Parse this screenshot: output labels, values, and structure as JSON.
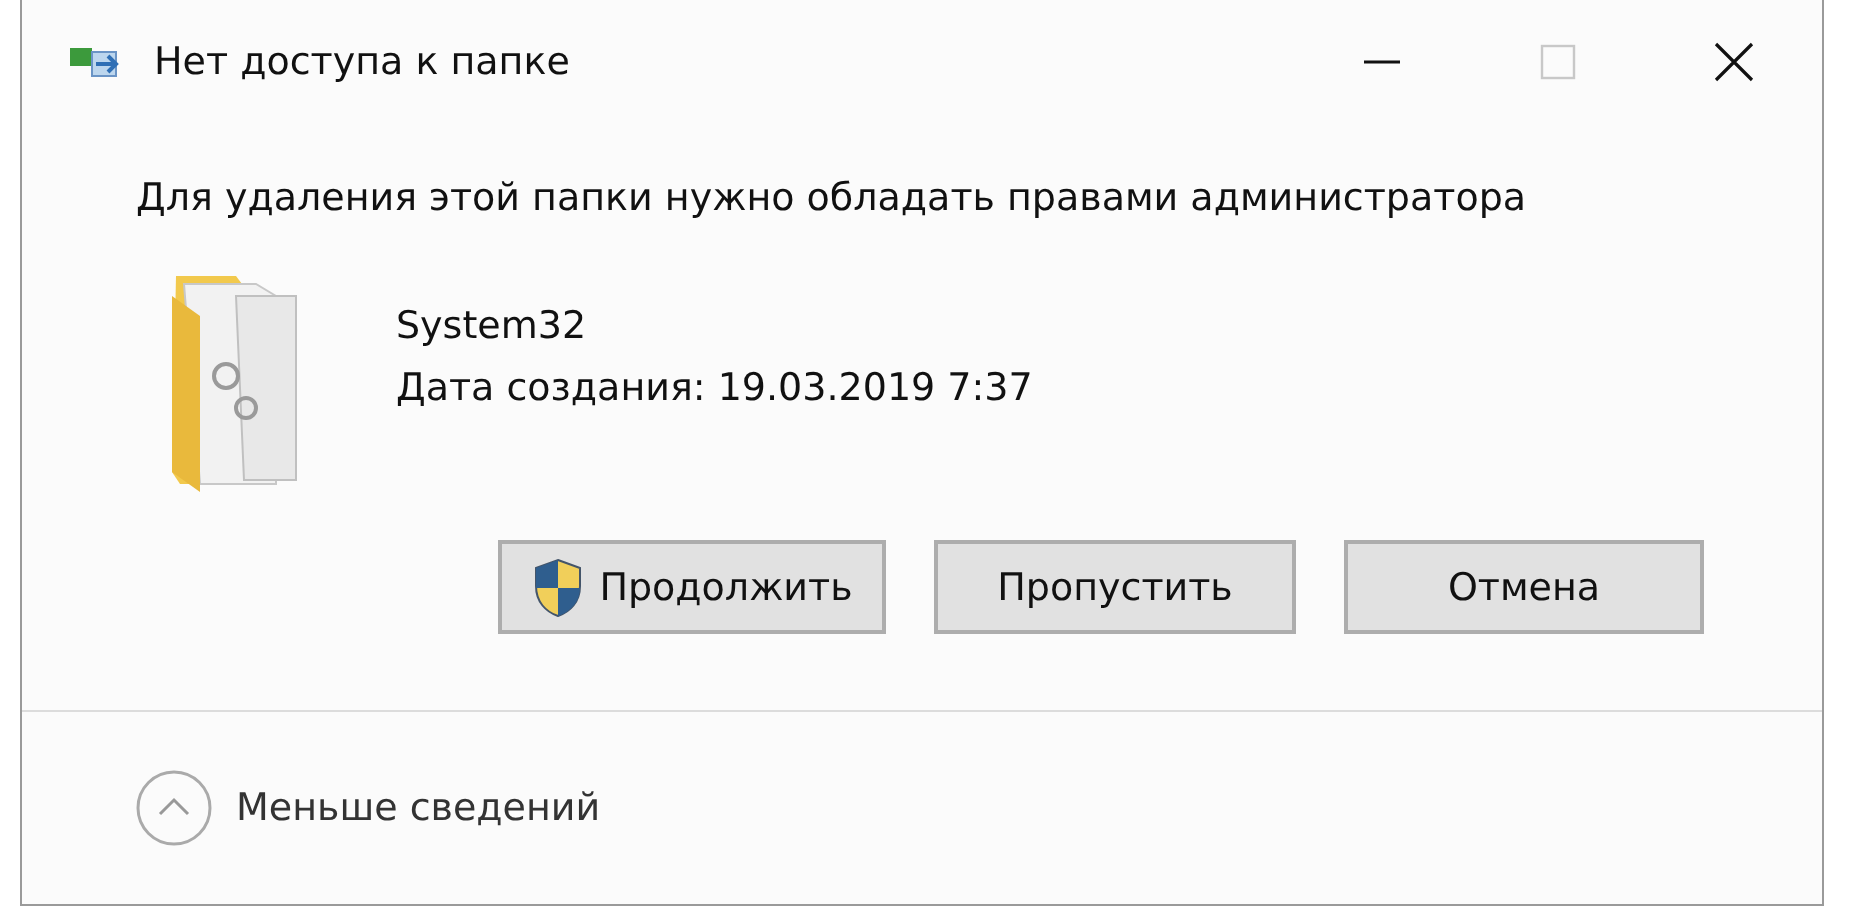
{
  "window": {
    "title": "Нет доступа к папке",
    "controls": [
      {
        "kind": "minimize",
        "disabled": false
      },
      {
        "kind": "maximize",
        "disabled": true
      },
      {
        "kind": "close",
        "disabled": false
      }
    ]
  },
  "message": "Для удаления этой папки нужно обладать правами администратора",
  "item": {
    "name": "System32",
    "details": "Дата создания: 19.03.2019 7:37"
  },
  "buttons": [
    {
      "label": "Продолжить",
      "shield": true
    },
    {
      "label": "Пропустить",
      "shield": false
    },
    {
      "label": "Отмена",
      "shield": false
    }
  ],
  "footer": {
    "label": "Меньше сведений",
    "expanded": true
  }
}
